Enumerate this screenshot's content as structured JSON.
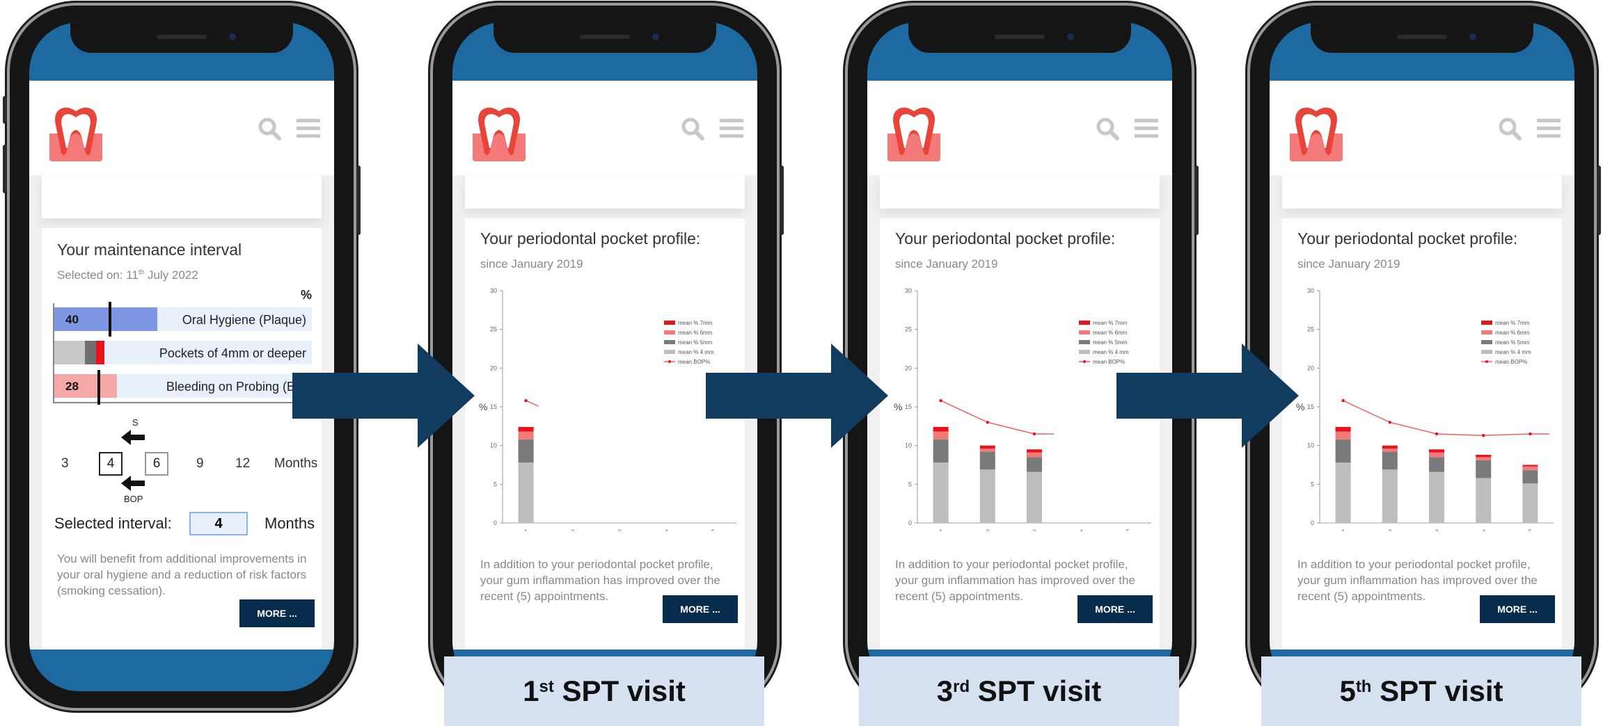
{
  "brand": {
    "accent": "#e8453a",
    "header_blue": "#1e6aa0",
    "button_navy": "#082c4c",
    "icon_grey": "#c8c8c8"
  },
  "phone1": {
    "card_title": "Your maintenance interval",
    "selected_prefix": "Selected on: 11",
    "selected_sup": "th",
    "selected_suffix": " July 2022",
    "percent_symbol": "%",
    "bars": [
      {
        "label": "Oral Hygiene (Plaque)",
        "value": "40",
        "color": "#7e97e3"
      },
      {
        "label": "Pockets of 4mm or deeper",
        "value": "",
        "color": "#c8c8c8"
      },
      {
        "label": "Bleeding on Probing (BOP)",
        "value": "28",
        "color": "#f5a8a8"
      }
    ],
    "s_label": "S",
    "bop_label": "BOP",
    "months": [
      "3",
      "4",
      "6",
      "9",
      "12"
    ],
    "months_label": "Months",
    "selected_interval_label": "Selected interval:",
    "selected_interval_value": "4",
    "selected_interval_unit": "Months",
    "description": "You will benefit from additional improvements in your oral hygiene and a reduction of risk factors (smoking cessation).",
    "more_button": "MORE ..."
  },
  "profile": {
    "title": "Your periodontal pocket profile:",
    "subtitle": "since January 2019",
    "description": "In addition to your periodontal pocket profile, your gum inflammation has improved over the recent (5) appointments.",
    "more_button": "MORE ..."
  },
  "visits": [
    {
      "num": "1",
      "sup": "st",
      "rest": " SPT visit"
    },
    {
      "num": "3",
      "sup": "rd",
      "rest": " SPT visit"
    },
    {
      "num": "5",
      "sup": "th",
      "rest": " SPT visit"
    }
  ],
  "chart_data": {
    "type": "bar",
    "ylabel": "%",
    "ylim": [
      0,
      30
    ],
    "yticks": [
      0,
      5,
      10,
      15,
      20,
      25,
      30
    ],
    "categories": [
      "1",
      "2",
      "3",
      "4",
      "5"
    ],
    "stacked": true,
    "legend_position": "right",
    "series": [
      {
        "name": "mean % 4 mm",
        "color": "#bdbdbd",
        "values": [
          7.8,
          6.9,
          6.6,
          5.8,
          5.1
        ]
      },
      {
        "name": "mean % 5mm",
        "color": "#7a7a7a",
        "values": [
          3.0,
          2.3,
          1.9,
          2.3,
          1.7
        ]
      },
      {
        "name": "mean % 6mm",
        "color": "#f47a7a",
        "values": [
          1.0,
          0.4,
          0.6,
          0.4,
          0.5
        ]
      },
      {
        "name": "mean % 7mm",
        "color": "#e8141c",
        "values": [
          0.6,
          0.4,
          0.4,
          0.3,
          0.2
        ]
      },
      {
        "name": "mean BOP%",
        "type": "line",
        "color": "#f06060",
        "values": [
          15.8,
          13.0,
          11.5,
          11.3,
          11.5
        ]
      }
    ],
    "legend_entries": [
      "mean % 7mm",
      "mean % 6mm",
      "mean % 5mm",
      "mean % 4 mm",
      "mean BOP%"
    ],
    "visible_per_phone": [
      1,
      3,
      5
    ]
  }
}
